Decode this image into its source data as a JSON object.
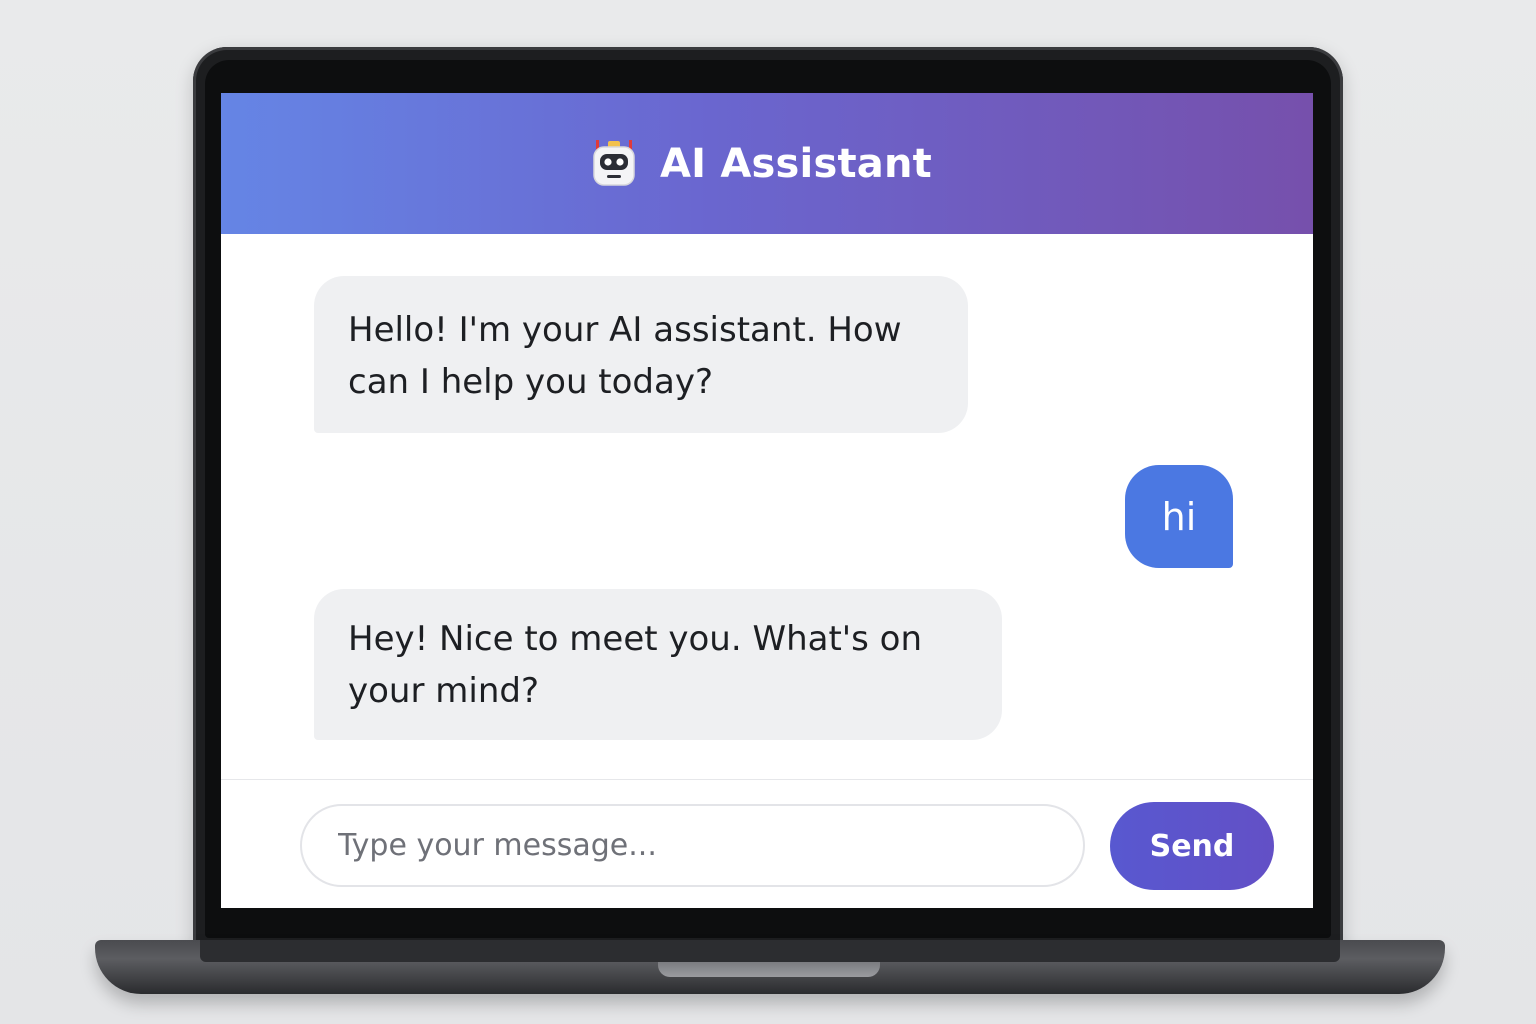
{
  "app": {
    "title": "AI Assistant",
    "icon": "robot-icon"
  },
  "messages": [
    {
      "sender": "assistant",
      "text": "Hello! I'm your AI assistant. How can I help you today?"
    },
    {
      "sender": "user",
      "text": "hi"
    },
    {
      "sender": "assistant",
      "text": "Hey! Nice to meet you. What's on your mind?"
    }
  ],
  "composer": {
    "placeholder": "Type your message...",
    "value": "",
    "send_label": "Send"
  },
  "colors": {
    "header_gradient_start": "#6585e5",
    "header_gradient_end": "#7650ac",
    "user_bubble": "#4b78e2",
    "assistant_bubble": "#eff0f2",
    "send_button": "#5858d0"
  }
}
